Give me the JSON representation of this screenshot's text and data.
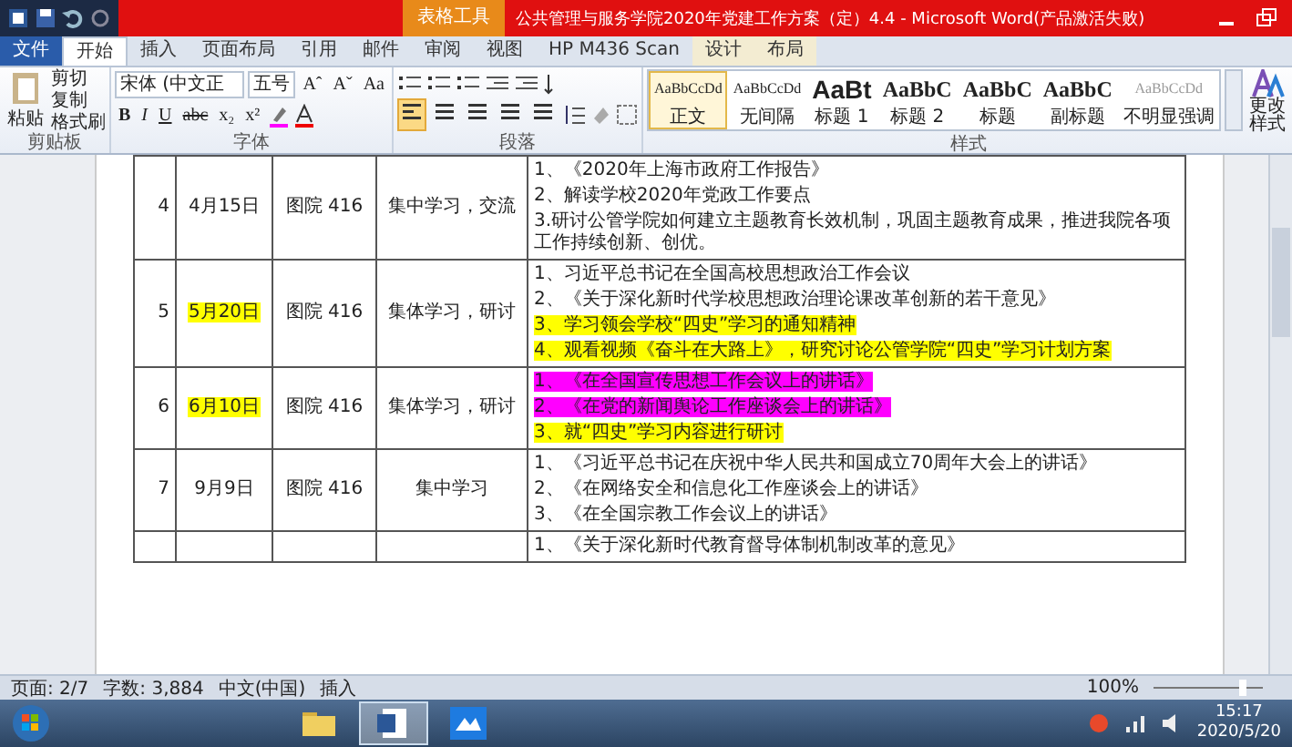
{
  "window": {
    "title": "公共管理与服务学院2020年党建工作方案（定）4.4 - Microsoft Word(产品激活失败)",
    "context_tab": "表格工具"
  },
  "ribbon_tabs": [
    {
      "label": "文件",
      "kind": "file",
      "selected": false
    },
    {
      "label": "开始",
      "kind": "normal",
      "selected": true
    },
    {
      "label": "插入",
      "kind": "normal",
      "selected": false
    },
    {
      "label": "页面布局",
      "kind": "normal",
      "selected": false
    },
    {
      "label": "引用",
      "kind": "normal",
      "selected": false
    },
    {
      "label": "邮件",
      "kind": "normal",
      "selected": false
    },
    {
      "label": "审阅",
      "kind": "normal",
      "selected": false
    },
    {
      "label": "视图",
      "kind": "normal",
      "selected": false
    },
    {
      "label": "HP M436 Scan",
      "kind": "normal",
      "selected": false
    },
    {
      "label": "设计",
      "kind": "context",
      "selected": false
    },
    {
      "label": "布局",
      "kind": "context",
      "selected": false
    }
  ],
  "clipboard": {
    "label": "剪贴板",
    "paste": "粘贴",
    "actions": [
      "剪切",
      "复制",
      "格式刷"
    ]
  },
  "font": {
    "label": "字体",
    "family": "宋体 (中文正",
    "size": "五号",
    "row1_buttons": [
      "Aˆ",
      "Aˇ",
      "Aa"
    ],
    "row2_buttons": [
      "B",
      "I",
      "U",
      "abc",
      "x₂",
      "x²"
    ]
  },
  "paragraph": {
    "label": "段落",
    "alignments": [
      {
        "selected": true
      },
      {
        "selected": false
      },
      {
        "selected": false
      },
      {
        "selected": false
      },
      {
        "selected": false
      }
    ]
  },
  "styles": {
    "label": "样式",
    "change": "更改样式",
    "items": [
      {
        "preview": "AaBbCcDd",
        "name": "正文",
        "kind": "small",
        "selected": true
      },
      {
        "preview": "AaBbCcDd",
        "name": "无间隔",
        "kind": "small",
        "selected": false
      },
      {
        "preview": "AaBt",
        "name": "标题 1",
        "kind": "heading1",
        "selected": false
      },
      {
        "preview": "AaBbC",
        "name": "标题 2",
        "kind": "heading",
        "selected": false
      },
      {
        "preview": "AaBbC",
        "name": "标题",
        "kind": "heading",
        "selected": false
      },
      {
        "preview": "AaBbC",
        "name": "副标题",
        "kind": "heading",
        "selected": false
      },
      {
        "preview": "AaBbCcDd",
        "name": "不明显强调",
        "kind": "subtle",
        "selected": false
      }
    ]
  },
  "document": {
    "rows": [
      {
        "no": "4",
        "date": "4月15日",
        "highlighted": false,
        "location": "图院 416",
        "form": "集中学习，交流",
        "items": [
          {
            "text": "1、《2020年上海市政府工作报告》"
          },
          {
            "text": "2、解读学校2020年党政工作要点"
          },
          {
            "text": "3.研讨公管学院如何建立主题教育长效机制，巩固主题教育成果，推进我院各项工作持续创新、创优。"
          }
        ]
      },
      {
        "no": "5",
        "date": "5月20日",
        "highlighted": true,
        "location": "图院 416",
        "form": "集体学习，研讨",
        "items": [
          {
            "text": "1、习近平总书记在全国高校思想政治工作会议"
          },
          {
            "text": "2、《关于深化新时代学校思想政治理论课改革创新的若干意见》"
          },
          {
            "text": "3、学习领会学校“四史”学习的通知精神",
            "color": "#ffff00"
          },
          {
            "text": "4、观看视频《奋斗在大路上》，研究讨论公管学院“四史”学习计划方案",
            "color": "#ffff00"
          }
        ]
      },
      {
        "no": "6",
        "date": "6月10日",
        "highlighted": true,
        "location": "图院 416",
        "form": "集体学习，研讨",
        "items": [
          {
            "text": "1、《在全国宣传思想工作会议上的讲话》",
            "color": "#ff00ff"
          },
          {
            "text": "2、《在党的新闻舆论工作座谈会上的讲话》",
            "color": "#ff00ff"
          },
          {
            "text": "3、就“四史”学习内容进行研讨",
            "color": "#ffff00"
          }
        ]
      },
      {
        "no": "7",
        "date": "9月9日",
        "highlighted": false,
        "location": "图院 416",
        "form": "集中学习",
        "items": [
          {
            "text": "1、《习近平总书记在庆祝中华人民共和国成立70周年大会上的讲话》"
          },
          {
            "text": "2、《在网络安全和信息化工作座谈会上的讲话》"
          },
          {
            "text": "3、《在全国宗教工作会议上的讲话》"
          }
        ]
      },
      {
        "items": [
          {
            "text": "1、《关于深化新时代教育督导体制机制改革的意见》"
          }
        ]
      }
    ]
  },
  "status_bar": {
    "items": [
      "页面: 2/7",
      "字数: 3,884",
      "中文(中国)",
      "插入"
    ],
    "zoom": {
      "label": "100%",
      "level": 0.85
    }
  },
  "taskbar": {
    "apps": [
      {
        "kind": "folder",
        "selected": false
      },
      {
        "kind": "word",
        "selected": true
      },
      {
        "kind": "cloud",
        "selected": false
      }
    ],
    "time": "15:17",
    "date": "2020/5/20"
  }
}
